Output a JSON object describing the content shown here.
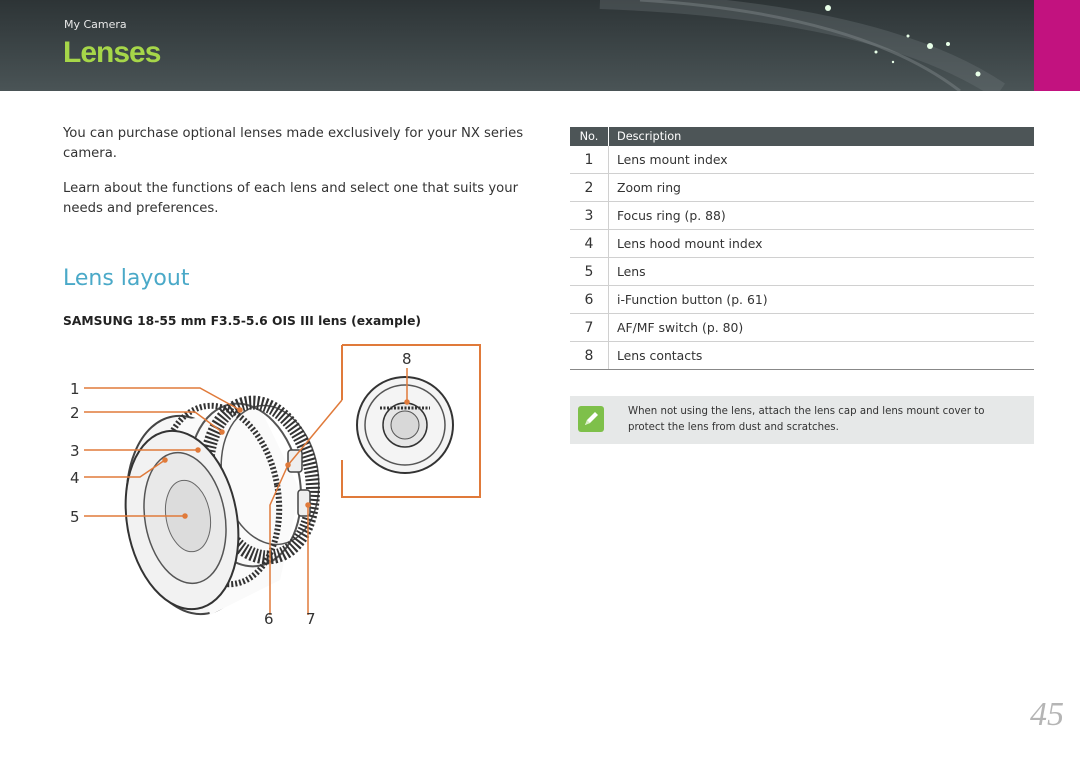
{
  "header": {
    "breadcrumb": "My Camera",
    "title": "Lenses",
    "title_color": "#a6d649",
    "tab_color": "#c2127f"
  },
  "intro": {
    "paragraph1": "You can purchase optional lenses made exclusively for your NX series camera.",
    "paragraph2": "Learn about the functions of each lens and select one that suits your needs and preferences."
  },
  "section": {
    "title": "Lens layout",
    "title_color": "#4aa9c8",
    "caption": "SAMSUNG 18-55 mm F3.5-5.6 OIS III lens (example)"
  },
  "figure": {
    "callouts": [
      "1",
      "2",
      "3",
      "4",
      "5",
      "6",
      "7",
      "8"
    ],
    "leader_color": "#e07a3a"
  },
  "table": {
    "headers": {
      "no": "No.",
      "description": "Description"
    },
    "rows": [
      {
        "no": "1",
        "description": "Lens mount index"
      },
      {
        "no": "2",
        "description": "Zoom ring"
      },
      {
        "no": "3",
        "description": "Focus ring (p. 88)"
      },
      {
        "no": "4",
        "description": "Lens hood mount index"
      },
      {
        "no": "5",
        "description": "Lens"
      },
      {
        "no": "6",
        "description": "i-Function button (p. 61)"
      },
      {
        "no": "7",
        "description": "AF/MF switch (p. 80)"
      },
      {
        "no": "8",
        "description": "Lens contacts"
      }
    ]
  },
  "note": {
    "icon": "pencil-note-icon",
    "text": "When not using the lens, attach the lens cap and lens mount cover to protect the lens from dust and scratches."
  },
  "page_number": "45"
}
